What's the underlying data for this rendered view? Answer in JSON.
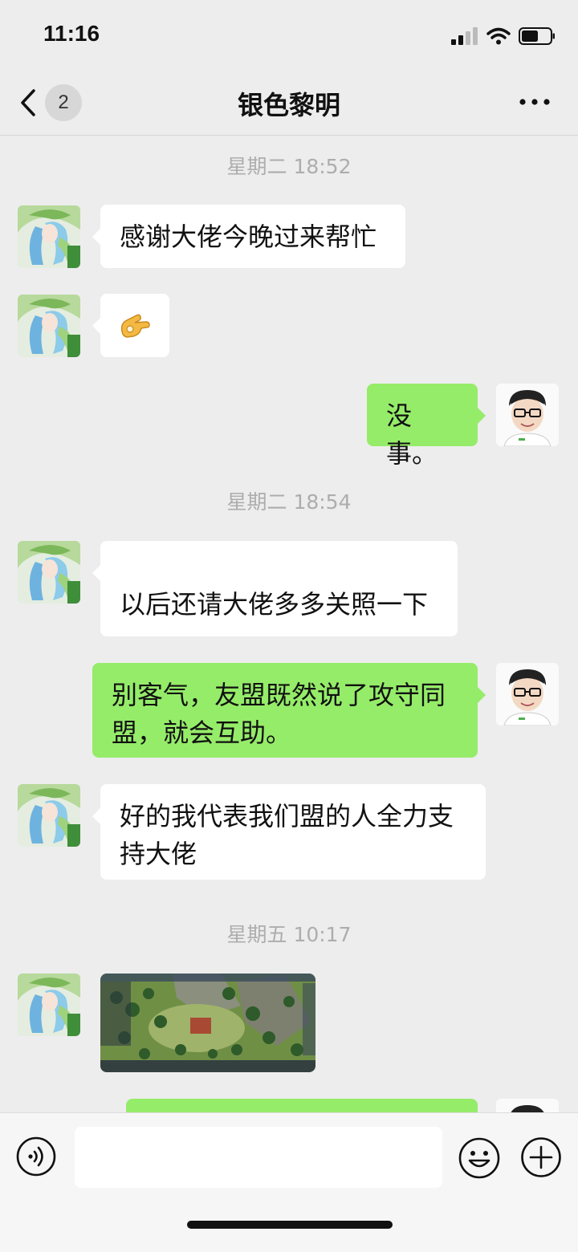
{
  "status_bar": {
    "time": "11:16"
  },
  "header": {
    "back_badge": "2",
    "title": "银色黎明"
  },
  "messages": [
    {
      "type": "timestamp",
      "text": "星期二 18:52"
    },
    {
      "type": "text",
      "side": "incoming",
      "text": "感谢大佬今晚过来帮忙"
    },
    {
      "type": "emoji",
      "side": "incoming",
      "text": "👌"
    },
    {
      "type": "text",
      "side": "outgoing",
      "text": "没事。"
    },
    {
      "type": "timestamp",
      "text": "星期二 18:54"
    },
    {
      "type": "text",
      "side": "incoming",
      "text": "以后还请大佬多多关照一下"
    },
    {
      "type": "text",
      "side": "outgoing",
      "text": "别客气，友盟既然说了攻守同盟，就会互助。"
    },
    {
      "type": "text",
      "side": "incoming",
      "text": "好的我代表我们盟的人全力支持大佬"
    },
    {
      "type": "timestamp",
      "text": "星期五 10:17"
    },
    {
      "type": "image",
      "side": "incoming"
    },
    {
      "type": "text",
      "side": "outgoing",
      "text": ""
    }
  ],
  "input_bar": {
    "value": ""
  },
  "colors": {
    "background": "#ededed",
    "outgoing_bubble": "#95ec69",
    "incoming_bubble": "#ffffff",
    "timestamp": "#adadad"
  },
  "icons": [
    "back-chevron-icon",
    "more-icon",
    "voice-icon",
    "emoji-icon",
    "plus-icon",
    "signal-icon",
    "wifi-icon",
    "battery-icon"
  ]
}
